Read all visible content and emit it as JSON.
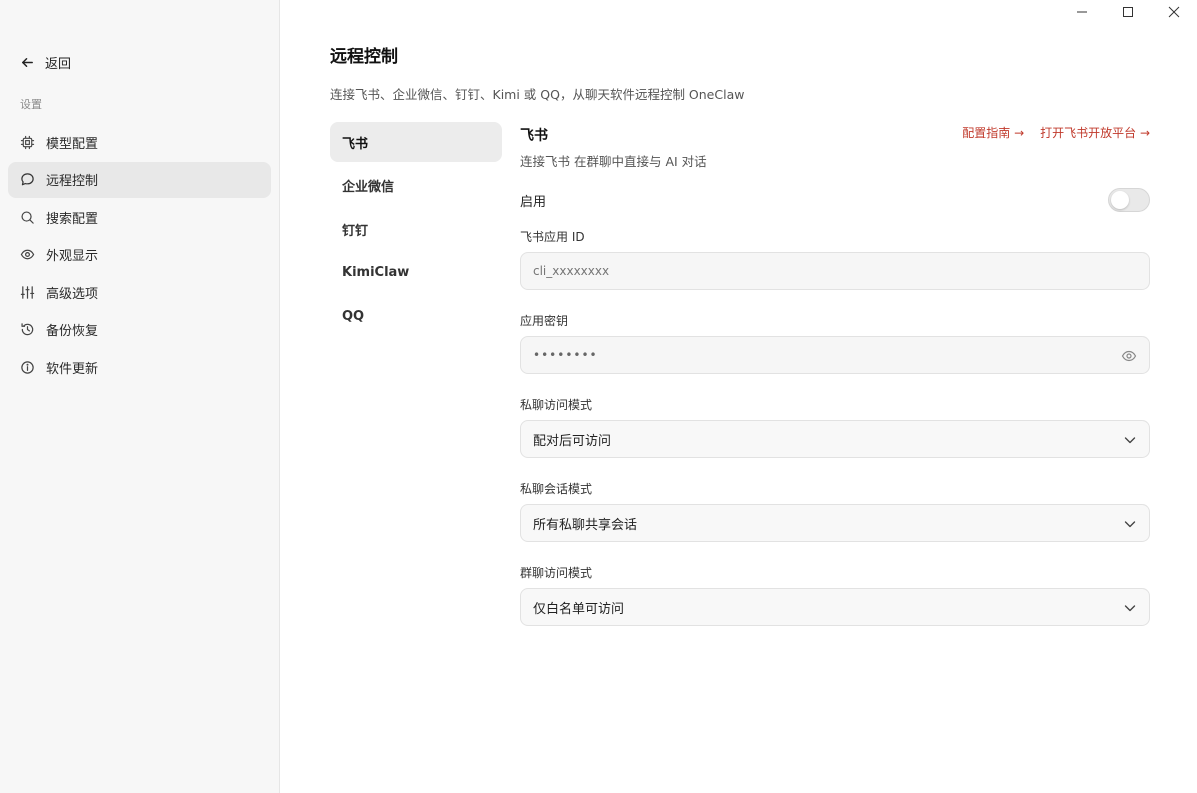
{
  "window": {
    "minimize_icon": "minimize-icon",
    "maximize_icon": "maximize-icon",
    "close_icon": "close-icon"
  },
  "sidebar": {
    "back_label": "返回",
    "section_label": "设置",
    "items": [
      {
        "label": "模型配置",
        "icon": "chip-icon",
        "active": false
      },
      {
        "label": "远程控制",
        "icon": "chat-bubble-icon",
        "active": true
      },
      {
        "label": "搜索配置",
        "icon": "search-icon",
        "active": false
      },
      {
        "label": "外观显示",
        "icon": "eye-icon",
        "active": false
      },
      {
        "label": "高级选项",
        "icon": "sliders-icon",
        "active": false
      },
      {
        "label": "备份恢复",
        "icon": "history-icon",
        "active": false
      },
      {
        "label": "软件更新",
        "icon": "info-icon",
        "active": false
      }
    ]
  },
  "main": {
    "title": "远程控制",
    "description": "连接飞书、企业微信、钉钉、Kimi 或 QQ，从聊天软件远程控制 OneClaw",
    "platforms": [
      {
        "label": "飞书",
        "active": true
      },
      {
        "label": "企业微信",
        "active": false
      },
      {
        "label": "钉钉",
        "active": false
      },
      {
        "label": "KimiClaw",
        "active": false
      },
      {
        "label": "QQ",
        "active": false
      }
    ],
    "panel": {
      "title": "飞书",
      "subtitle": "连接飞书 在群聊中直接与 AI 对话",
      "guide_link": "配置指南 →",
      "open_platform_link": "打开飞书开放平台 →",
      "enable_label": "启用",
      "enabled": false,
      "app_id_label": "飞书应用 ID",
      "app_id_placeholder": "cli_xxxxxxxx",
      "app_secret_label": "应用密钥",
      "app_secret_value": "••••••••",
      "dm_access_label": "私聊访问模式",
      "dm_access_value": "配对后可访问",
      "dm_session_label": "私聊会话模式",
      "dm_session_value": "所有私聊共享会话",
      "group_access_label": "群聊访问模式",
      "group_access_value": "仅白名单可访问"
    }
  },
  "colors": {
    "accent_link": "#c0392b",
    "sidebar_bg": "#f7f7f7",
    "active_item_bg": "#e8e8e8"
  }
}
